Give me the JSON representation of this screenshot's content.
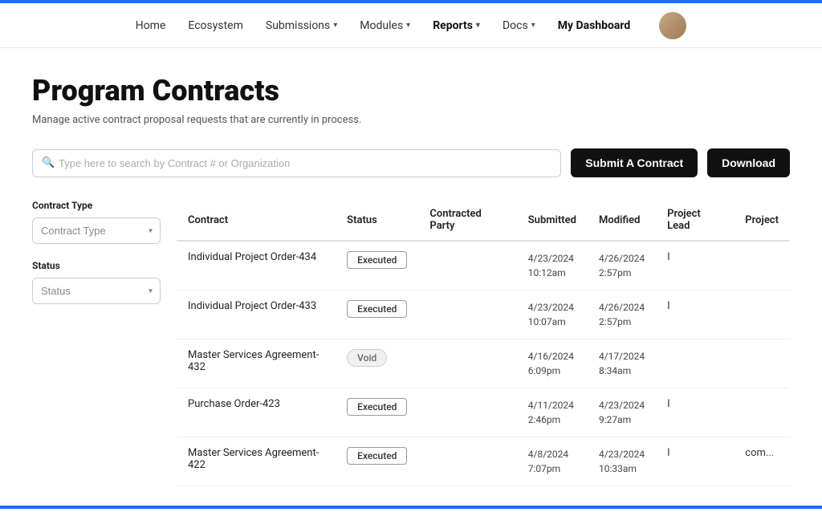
{
  "topBorder": true,
  "nav": {
    "items": [
      {
        "label": "Home",
        "active": false,
        "hasDropdown": false
      },
      {
        "label": "Ecosystem",
        "active": false,
        "hasDropdown": false
      },
      {
        "label": "Submissions",
        "active": false,
        "hasDropdown": true
      },
      {
        "label": "Modules",
        "active": false,
        "hasDropdown": true
      },
      {
        "label": "Reports",
        "active": true,
        "hasDropdown": true
      },
      {
        "label": "Docs",
        "active": false,
        "hasDropdown": true
      },
      {
        "label": "My Dashboard",
        "active": false,
        "hasDropdown": false
      }
    ]
  },
  "page": {
    "title": "Program Contracts",
    "subtitle": "Manage active contract proposal requests that are currently in process.",
    "search": {
      "placeholder": "Type here to search by Contract # or Organization"
    },
    "buttons": {
      "submit": "Submit A Contract",
      "download": "Download"
    }
  },
  "filters": {
    "contractType": {
      "label": "Contract Type",
      "placeholder": "Contract Type"
    },
    "status": {
      "label": "Status",
      "placeholder": "Status"
    }
  },
  "table": {
    "headers": [
      "Contract",
      "Status",
      "Contracted Party",
      "Submitted",
      "Modified",
      "Project Lead",
      "Project"
    ],
    "rows": [
      {
        "contract": "Individual Project Order-434",
        "status": "Executed",
        "statusType": "executed",
        "contractedParty": "",
        "submitted": "4/23/2024\n10:12am",
        "modified": "4/26/2024\n2:57pm",
        "projectLead": "I",
        "project": ""
      },
      {
        "contract": "Individual Project Order-433",
        "status": "Executed",
        "statusType": "executed",
        "contractedParty": "",
        "submitted": "4/23/2024\n10:07am",
        "modified": "4/26/2024\n2:57pm",
        "projectLead": "I",
        "project": ""
      },
      {
        "contract": "Master Services Agreement-432",
        "status": "Void",
        "statusType": "void",
        "contractedParty": "",
        "submitted": "4/16/2024\n6:09pm",
        "modified": "4/17/2024\n8:34am",
        "projectLead": "",
        "project": ""
      },
      {
        "contract": "Purchase Order-423",
        "status": "Executed",
        "statusType": "executed",
        "contractedParty": "",
        "submitted": "4/11/2024\n2:46pm",
        "modified": "4/23/2024\n9:27am",
        "projectLead": "I",
        "project": ""
      },
      {
        "contract": "Master Services Agreement-422",
        "status": "Executed",
        "statusType": "executed",
        "contractedParty": "",
        "submitted": "4/8/2024\n7:07pm",
        "modified": "4/23/2024\n10:33am",
        "projectLead": "I",
        "project": "com..."
      }
    ]
  }
}
